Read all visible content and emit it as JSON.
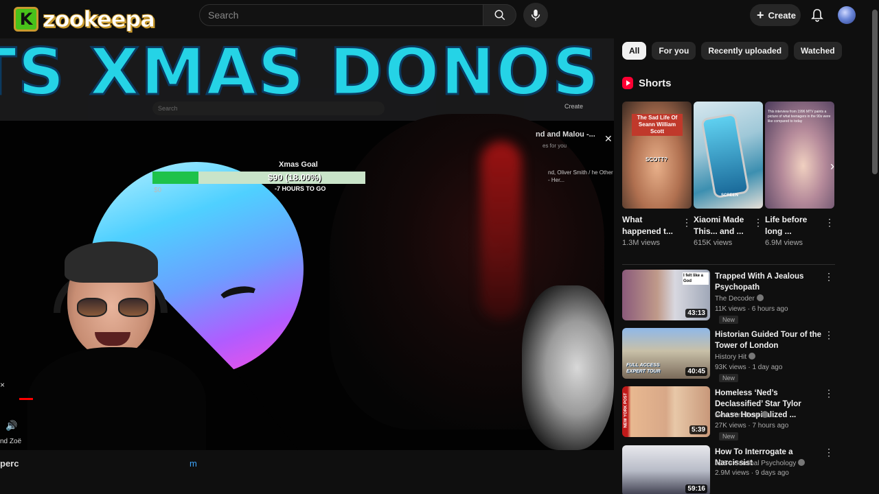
{
  "logo": {
    "badge": "K",
    "text": "zookeepa"
  },
  "search": {
    "placeholder": "Search"
  },
  "header": {
    "create_label": "Create"
  },
  "video": {
    "overlay_banner": "TS XMAS DONOS",
    "inner_search": "Search",
    "inner_create": "Create",
    "xmas_goal": {
      "title": "Xmas Goal",
      "amount": "$90 (18.00%)",
      "hours_left": "-7 HOURS TO GO",
      "start": "$0",
      "progress": 0.18
    },
    "inner_side_title": "nd and Malou -...",
    "inner_side_sub": "es for you",
    "inner_side_2": "nd, Oliver Smith / he Other - Her...",
    "side_x": "×",
    "side_name": "nd Zoë",
    "under_left": "perc",
    "under_link": "m"
  },
  "chips": [
    {
      "label": "All",
      "active": true
    },
    {
      "label": "For you",
      "active": false
    },
    {
      "label": "Recently uploaded",
      "active": false
    },
    {
      "label": "Watched",
      "active": false
    }
  ],
  "shorts": {
    "heading": "Shorts",
    "items": [
      {
        "title": "What happened t...",
        "views": "1.3M views",
        "thumb_caption": "The Sad Life Of Seann William Scott",
        "overlay": "SCOTT?",
        "colors": [
          "#c0392b",
          "#e8b08a"
        ]
      },
      {
        "title": "Xiaomi Made This... and ...",
        "views": "615K views",
        "thumb_caption": "SCREEN",
        "overlay": "",
        "colors": [
          "#cfe0e8",
          "#4aa3c8"
        ]
      },
      {
        "title": "Life before long ...",
        "views": "6.9M views",
        "thumb_caption": "This interview from 1996 MTV paints a picture of what teenagers in the 90s were like compared to today",
        "overlay": "",
        "colors": [
          "#e8d8f0",
          "#9a7fae"
        ]
      }
    ]
  },
  "recommendations": [
    {
      "title": "Trapped With A Jealous Psychopath",
      "channel": "The Decoder",
      "meta": "11K views · 6 hours ago",
      "badge": "New",
      "duration": "43:13",
      "thumb_text": "I felt like a God",
      "verified": true
    },
    {
      "title": "Historian Guided Tour of the Tower of London",
      "channel": "History Hit",
      "meta": "93K views · 1 day ago",
      "badge": "New",
      "duration": "40:45",
      "thumb_text": "FULL ACCESS EXPERT TOUR",
      "verified": true
    },
    {
      "title": "Homeless ‘Ned’s Declassified’ Star Tylor Chase Hospitalized ...",
      "channel": "New York Post",
      "meta": "27K views · 7 hours ago",
      "badge": "New",
      "duration": "5:39",
      "thumb_text": "NEW YORK POST",
      "verified": true
    },
    {
      "title": "How To Interrogate a Narcissist",
      "channel": "JCS - Criminal Psychology",
      "meta": "2.9M views · 9 days ago",
      "badge": "",
      "duration": "59:16",
      "thumb_text": "",
      "verified": true
    }
  ]
}
